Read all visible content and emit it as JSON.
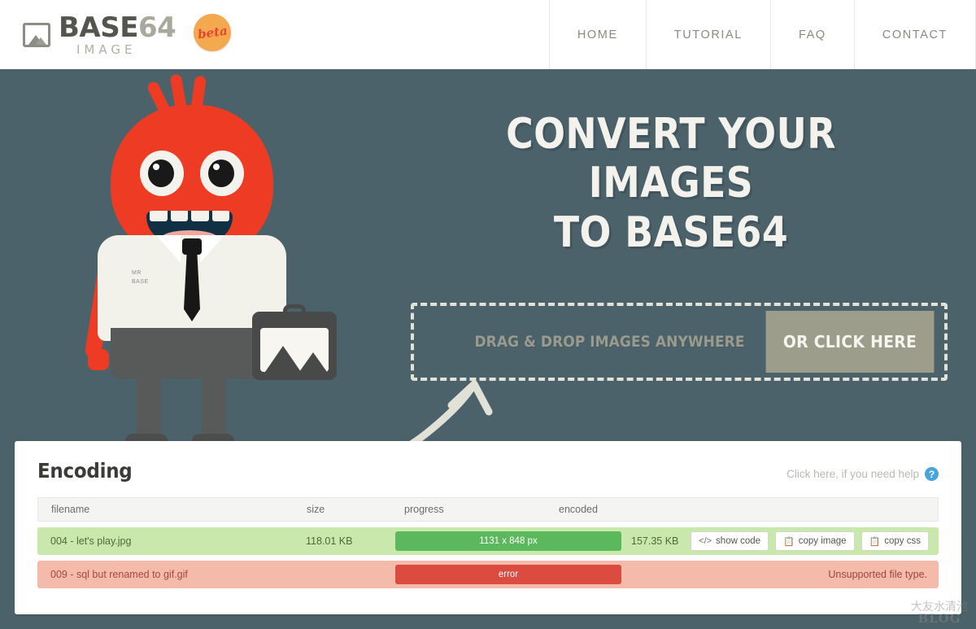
{
  "header": {
    "logo": {
      "icon": "image-picture-icon",
      "text_main": "BASE",
      "text_accent": "64",
      "text_sub": "IMAGE",
      "badge": "beta"
    },
    "nav": [
      {
        "label": "HOME",
        "active": true
      },
      {
        "label": "TUTORIAL",
        "active": false
      },
      {
        "label": "FAQ",
        "active": false
      },
      {
        "label": "CONTACT",
        "active": false
      }
    ]
  },
  "hero": {
    "title_line1": "CONVERT YOUR IMAGES",
    "title_line2": "TO BASE64",
    "mascot_shirt_line1": "MR",
    "mascot_shirt_line2": "BASE",
    "dropzone": {
      "text": "DRAG & DROP IMAGES ANYWHERE",
      "button": "OR CLICK HERE"
    }
  },
  "panel": {
    "title": "Encoding",
    "help_text": "Click here, if you need help",
    "help_icon": "question-mark-icon",
    "columns": {
      "filename": "filename",
      "size": "size",
      "progress": "progress",
      "encoded": "encoded"
    },
    "rows": [
      {
        "status": "ok",
        "filename": "004 - let's play.jpg",
        "size": "118.01 KB",
        "progress": "1131 x 848 px",
        "encoded": "157.35 KB",
        "actions": [
          {
            "label": "show code",
            "icon": "code-icon"
          },
          {
            "label": "copy image",
            "icon": "copy-icon"
          },
          {
            "label": "copy css",
            "icon": "copy-icon"
          }
        ]
      },
      {
        "status": "error",
        "filename": "009 - sql but renamed to gif.gif",
        "size": "",
        "progress": "error",
        "encoded": "",
        "message": "Unsupported file type."
      }
    ]
  },
  "watermark": {
    "line1": "大友水清池",
    "line2": "BLOG"
  },
  "colors": {
    "page_bg": "#4c626b",
    "header_bg": "#ffffff",
    "accent_badge": "#f5a94f",
    "accent_badge_text": "#e8452e",
    "mascot_red": "#ee3b24",
    "button_khaki": "#9d9d8c",
    "success_row": "#c9e8ac",
    "success_bar": "#5cb85c",
    "error_row": "#f4bbab",
    "error_bar": "#dc4b40",
    "help_blue": "#4ba3de"
  }
}
